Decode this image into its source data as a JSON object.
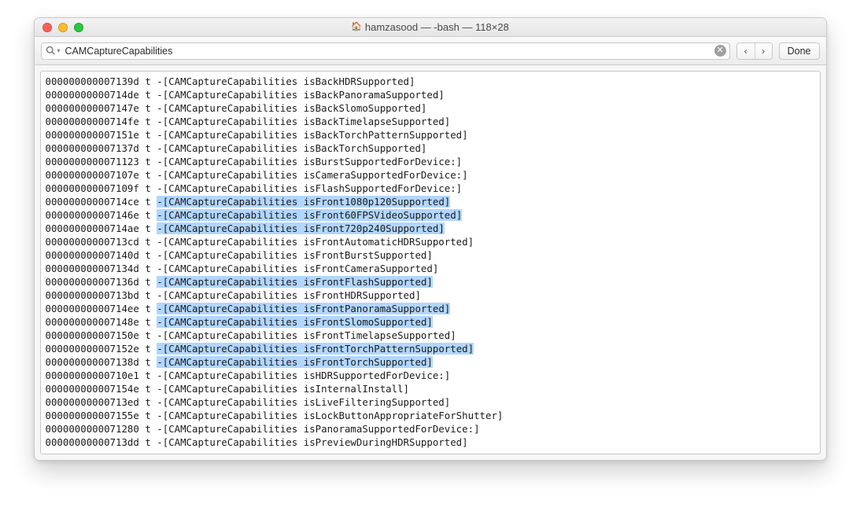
{
  "window": {
    "title": "hamzasood — -bash — 118×28"
  },
  "toolbar": {
    "search_value": "CAMCaptureCapabilities",
    "done_label": "Done"
  },
  "terminal": {
    "lines": [
      {
        "addr": "000000000007139d",
        "type": "t",
        "class": "CAMCaptureCapabilities",
        "method": "isBackHDRSupported",
        "highlighted": false
      },
      {
        "addr": "00000000000714de",
        "type": "t",
        "class": "CAMCaptureCapabilities",
        "method": "isBackPanoramaSupported",
        "highlighted": false
      },
      {
        "addr": "000000000007147e",
        "type": "t",
        "class": "CAMCaptureCapabilities",
        "method": "isBackSlomoSupported",
        "highlighted": false
      },
      {
        "addr": "00000000000714fe",
        "type": "t",
        "class": "CAMCaptureCapabilities",
        "method": "isBackTimelapseSupported",
        "highlighted": false
      },
      {
        "addr": "000000000007151e",
        "type": "t",
        "class": "CAMCaptureCapabilities",
        "method": "isBackTorchPatternSupported",
        "highlighted": false
      },
      {
        "addr": "000000000007137d",
        "type": "t",
        "class": "CAMCaptureCapabilities",
        "method": "isBackTorchSupported",
        "highlighted": false
      },
      {
        "addr": "0000000000071123",
        "type": "t",
        "class": "CAMCaptureCapabilities",
        "method": "isBurstSupportedForDevice:",
        "highlighted": false
      },
      {
        "addr": "000000000007107e",
        "type": "t",
        "class": "CAMCaptureCapabilities",
        "method": "isCameraSupportedForDevice:",
        "highlighted": false
      },
      {
        "addr": "000000000007109f",
        "type": "t",
        "class": "CAMCaptureCapabilities",
        "method": "isFlashSupportedForDevice:",
        "highlighted": false
      },
      {
        "addr": "00000000000714ce",
        "type": "t",
        "class": "CAMCaptureCapabilities",
        "method": "isFront1080p120Supported",
        "highlighted": true
      },
      {
        "addr": "000000000007146e",
        "type": "t",
        "class": "CAMCaptureCapabilities",
        "method": "isFront60FPSVideoSupported",
        "highlighted": true
      },
      {
        "addr": "00000000000714ae",
        "type": "t",
        "class": "CAMCaptureCapabilities",
        "method": "isFront720p240Supported",
        "highlighted": true
      },
      {
        "addr": "00000000000713cd",
        "type": "t",
        "class": "CAMCaptureCapabilities",
        "method": "isFrontAutomaticHDRSupported",
        "highlighted": false
      },
      {
        "addr": "000000000007140d",
        "type": "t",
        "class": "CAMCaptureCapabilities",
        "method": "isFrontBurstSupported",
        "highlighted": false
      },
      {
        "addr": "000000000007134d",
        "type": "t",
        "class": "CAMCaptureCapabilities",
        "method": "isFrontCameraSupported",
        "highlighted": false
      },
      {
        "addr": "000000000007136d",
        "type": "t",
        "class": "CAMCaptureCapabilities",
        "method": "isFrontFlashSupported",
        "highlighted": true
      },
      {
        "addr": "00000000000713bd",
        "type": "t",
        "class": "CAMCaptureCapabilities",
        "method": "isFrontHDRSupported",
        "highlighted": false
      },
      {
        "addr": "00000000000714ee",
        "type": "t",
        "class": "CAMCaptureCapabilities",
        "method": "isFrontPanoramaSupported",
        "highlighted": true
      },
      {
        "addr": "000000000007148e",
        "type": "t",
        "class": "CAMCaptureCapabilities",
        "method": "isFrontSlomoSupported",
        "highlighted": true
      },
      {
        "addr": "000000000007150e",
        "type": "t",
        "class": "CAMCaptureCapabilities",
        "method": "isFrontTimelapseSupported",
        "highlighted": false
      },
      {
        "addr": "000000000007152e",
        "type": "t",
        "class": "CAMCaptureCapabilities",
        "method": "isFrontTorchPatternSupported",
        "highlighted": true
      },
      {
        "addr": "000000000007138d",
        "type": "t",
        "class": "CAMCaptureCapabilities",
        "method": "isFrontTorchSupported",
        "highlighted": true
      },
      {
        "addr": "00000000000710e1",
        "type": "t",
        "class": "CAMCaptureCapabilities",
        "method": "isHDRSupportedForDevice:",
        "highlighted": false
      },
      {
        "addr": "000000000007154e",
        "type": "t",
        "class": "CAMCaptureCapabilities",
        "method": "isInternalInstall",
        "highlighted": false
      },
      {
        "addr": "00000000000713ed",
        "type": "t",
        "class": "CAMCaptureCapabilities",
        "method": "isLiveFilteringSupported",
        "highlighted": false
      },
      {
        "addr": "000000000007155e",
        "type": "t",
        "class": "CAMCaptureCapabilities",
        "method": "isLockButtonAppropriateForShutter",
        "highlighted": false
      },
      {
        "addr": "0000000000071280",
        "type": "t",
        "class": "CAMCaptureCapabilities",
        "method": "isPanoramaSupportedForDevice:",
        "highlighted": false
      },
      {
        "addr": "00000000000713dd",
        "type": "t",
        "class": "CAMCaptureCapabilities",
        "method": "isPreviewDuringHDRSupported",
        "highlighted": false
      }
    ]
  }
}
